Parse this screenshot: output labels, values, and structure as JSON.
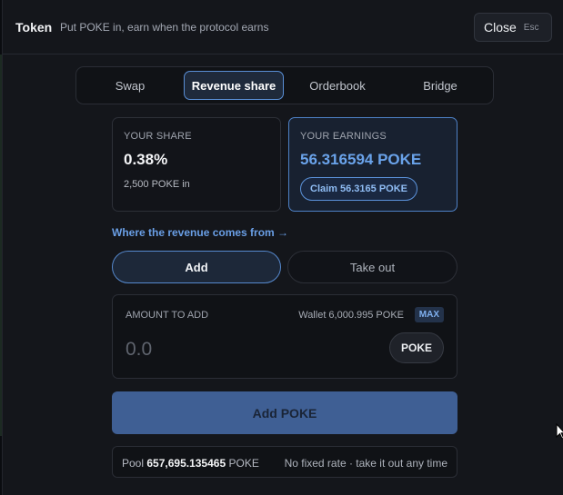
{
  "header": {
    "title": "Token",
    "subtitle": "Put POKE in, earn when the protocol earns",
    "close_label": "Close",
    "close_shortcut": "Esc"
  },
  "tabs": [
    {
      "label": "Swap",
      "active": false
    },
    {
      "label": "Revenue share",
      "active": true
    },
    {
      "label": "Orderbook",
      "active": false
    },
    {
      "label": "Bridge",
      "active": false
    }
  ],
  "share": {
    "caption": "YOUR SHARE",
    "percent": "0.38%",
    "detail": "2,500 POKE in"
  },
  "earnings": {
    "caption": "YOUR EARNINGS",
    "amount": "56.316594 POKE",
    "claim_label": "Claim 56.3165 POKE"
  },
  "revenue_link": "Where the revenue comes from →",
  "mode": {
    "add_label": "Add",
    "take_label": "Take out",
    "selected": "Add"
  },
  "amount": {
    "caption": "AMOUNT TO ADD",
    "wallet": "Wallet 6,000.995 POKE",
    "max_label": "MAX",
    "placeholder": "0.0",
    "value": "",
    "token": "POKE"
  },
  "submit_label": "Add POKE",
  "pool": {
    "prefix": "Pool",
    "amount": "657,695.135465",
    "unit": "POKE",
    "note": "No fixed rate · take it out any time"
  },
  "colors": {
    "accent": "#5a8fd6",
    "earnings": "#6aa3ea",
    "submit": "#3f5f94",
    "background": "#14161b"
  }
}
